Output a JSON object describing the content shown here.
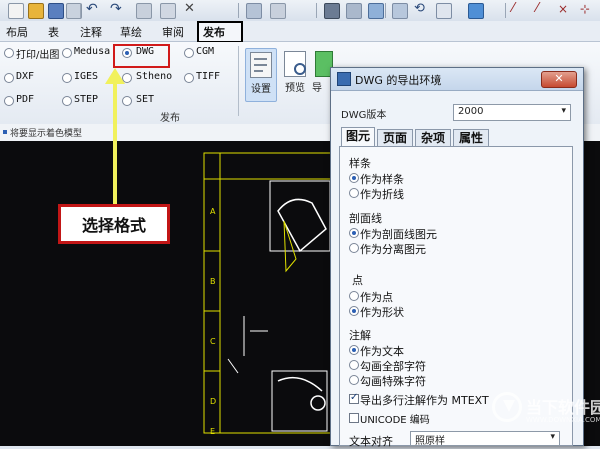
{
  "tabs": [
    "布局",
    "表",
    "注释",
    "草绘",
    "审阅",
    "发布"
  ],
  "ribbon": {
    "formats": [
      {
        "label": "打印/出图",
        "selected": false
      },
      {
        "label": "Medusa",
        "selected": false
      },
      {
        "label": "DWG",
        "selected": true
      },
      {
        "label": "CGM",
        "selected": false
      },
      {
        "label": "DXF",
        "selected": false
      },
      {
        "label": "IGES",
        "selected": false
      },
      {
        "label": "Stheno",
        "selected": false
      },
      {
        "label": "TIFF",
        "selected": false
      },
      {
        "label": "PDF",
        "selected": false
      },
      {
        "label": "STEP",
        "selected": false
      },
      {
        "label": "SET",
        "selected": false
      }
    ],
    "settings_label": "设置",
    "preview_label": "预览",
    "export_label": "导",
    "group_label": "发布"
  },
  "status_text": "将要显示着色模型",
  "annotation": {
    "callout": "选择格式",
    "arrow_color": "#f1f15c",
    "box_color": "#c21616"
  },
  "dialog": {
    "title": "DWG 的导出环境",
    "close_label": "✕",
    "version_label": "DWG版本",
    "version_value": "2000",
    "tabs": [
      "图元",
      "页面",
      "杂项",
      "属性"
    ],
    "sections": [
      {
        "title": "样条",
        "options": [
          {
            "label": "作为样条",
            "selected": true
          },
          {
            "label": "作为折线",
            "selected": false
          }
        ]
      },
      {
        "title": "剖面线",
        "options": [
          {
            "label": "作为剖面线图元",
            "selected": true
          },
          {
            "label": "作为分离图元",
            "selected": false
          }
        ]
      },
      {
        "title": "点",
        "options": [
          {
            "label": "作为点",
            "selected": false
          },
          {
            "label": "作为形状",
            "selected": true
          }
        ]
      },
      {
        "title": "注解",
        "options": [
          {
            "label": "作为文本",
            "selected": true
          },
          {
            "label": "勾画全部字符",
            "selected": false
          },
          {
            "label": "勾画特殊字符",
            "selected": false
          }
        ]
      }
    ],
    "check_mtext": {
      "label": "导出多行注解作为 MTEXT",
      "checked": true
    },
    "check_unicode": {
      "label": "UNICODE 编码",
      "checked": false
    },
    "text_align_label": "文本对齐",
    "text_align_value": "照原样"
  },
  "drawing_labels": [
    "A",
    "B",
    "C",
    "D",
    "E"
  ],
  "watermark": {
    "line1": "当下软件园",
    "line2": "WWW.DOWNXIA.COM"
  }
}
